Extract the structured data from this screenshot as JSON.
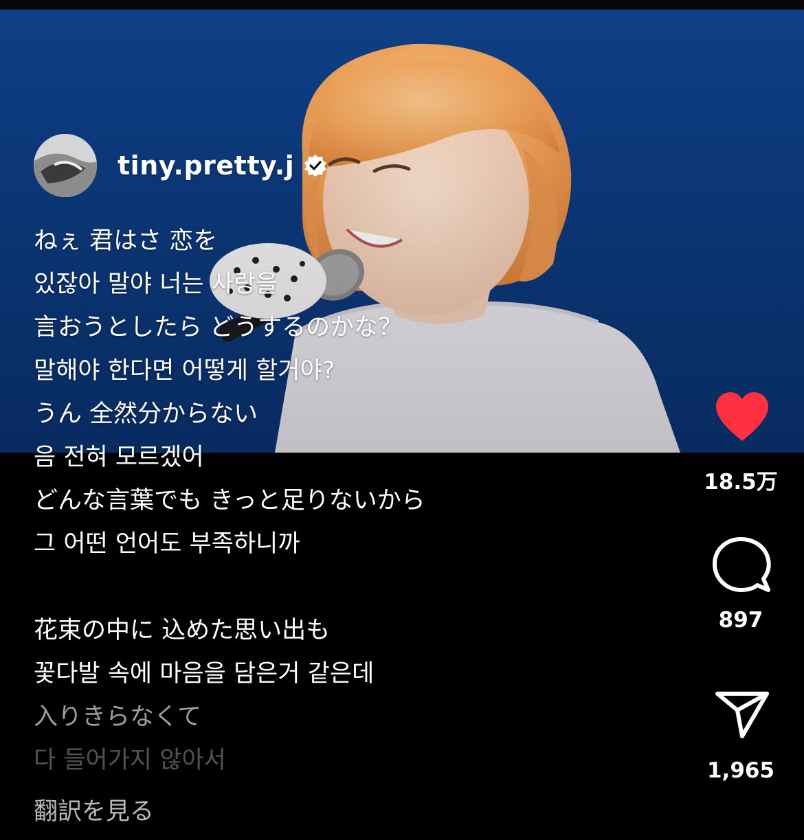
{
  "post": {
    "username": "tiny.pretty.j",
    "verified": true
  },
  "caption": {
    "lines": [
      "ねぇ 君はさ 恋を",
      "있잖아 말야 너는 사랑을",
      "言おうとしたら どうするのかな？",
      "말해야 한다면 어떻게 할거야?",
      "うん 全然分からない",
      "음 전혀 모르겠어",
      "どんな言葉でも きっと足りないから",
      "그 어떤 언어도 부족하니까",
      "",
      "花束の中に 込めた思い出も",
      "꽃다발 속에 마음을 담은거 같은데",
      "入りきらなくて",
      "다 들어가지 않아서"
    ],
    "see_translation": "翻訳を見る"
  },
  "actions": {
    "likes": "18.5万",
    "comments": "897",
    "shares": "1,965"
  },
  "colors": {
    "like_heart": "#ff3040",
    "video_background": "#0c3a7e",
    "hair": "#f0a45a"
  },
  "icons": {
    "verified": "verified-badge-icon",
    "like": "heart-filled-icon",
    "comment": "comment-bubble-icon",
    "share": "paper-plane-icon"
  }
}
